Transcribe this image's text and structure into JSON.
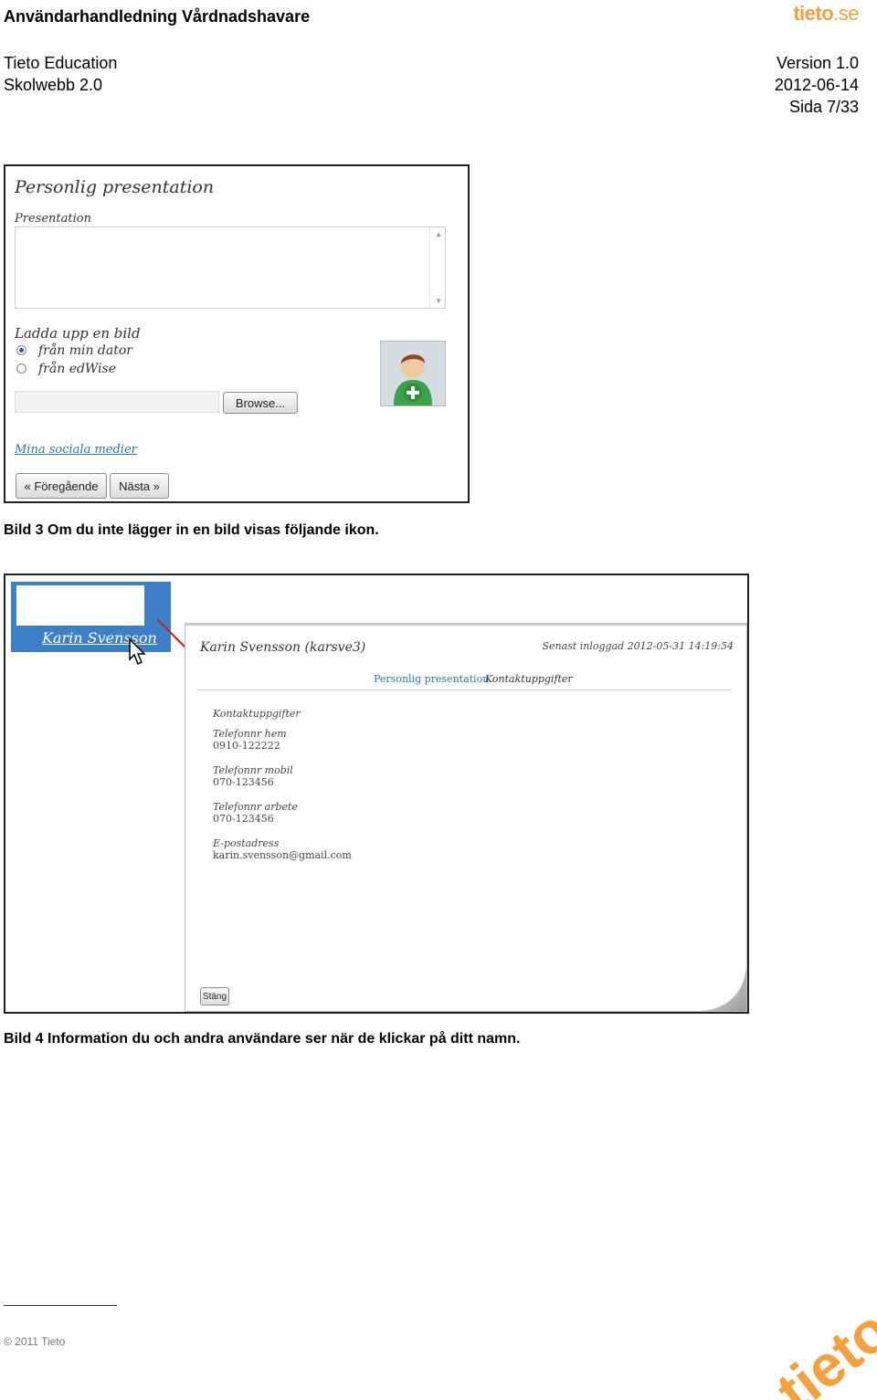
{
  "header": {
    "doc_title": "Användarhandledning Vårdnadshavare",
    "logo_top": "tieto",
    "logo_top_suffix": ".se",
    "company": "Tieto Education",
    "product": "Skolwebb 2.0",
    "version": "Version 1.0",
    "date": "2012-06-14",
    "page": "Sida 7/33"
  },
  "screenshot1": {
    "title": "Personlig presentation",
    "presentation_label": "Presentation",
    "presentation_value": "",
    "upload_label": "Ladda upp en bild",
    "radio_options": [
      "från min dator",
      "från edWise"
    ],
    "selected_option": "från min dator",
    "file_input_value": "",
    "browse_label": "Browse...",
    "social_link": "Mina sociala medier",
    "prev_button": "« Föregående",
    "next_button": "Nästa »",
    "avatar_icon": "add-user-icon"
  },
  "caption1": "Bild 3 Om du inte lägger in en bild visas följande ikon.",
  "screenshot2": {
    "zoom_name": "Karin Svensson",
    "profile_name": "Karin Svensson (karsve3)",
    "last_login": "Senast inloggad 2012-05-31 14:19:54",
    "tabs": [
      "Personlig presentation",
      "Kontaktuppgifter"
    ],
    "section_title": "Kontaktuppgifter",
    "fields": [
      {
        "label": "Telefonnr hem",
        "value": "0910-122222"
      },
      {
        "label": "Telefonnr mobil",
        "value": "070-123456"
      },
      {
        "label": "Telefonnr arbete",
        "value": "070-123456"
      },
      {
        "label": "E-postadress",
        "value": "karin.svensson@gmail.com"
      }
    ],
    "close_button": "Stäng",
    "arrow_color": "#cc2222"
  },
  "caption2": "Bild 4 Information du och andra användare ser när de klickar på ditt namn.",
  "footer": {
    "copyright": "© 2011 Tieto",
    "logo_text": "tieto",
    "logo_color": "#f5a03a"
  }
}
